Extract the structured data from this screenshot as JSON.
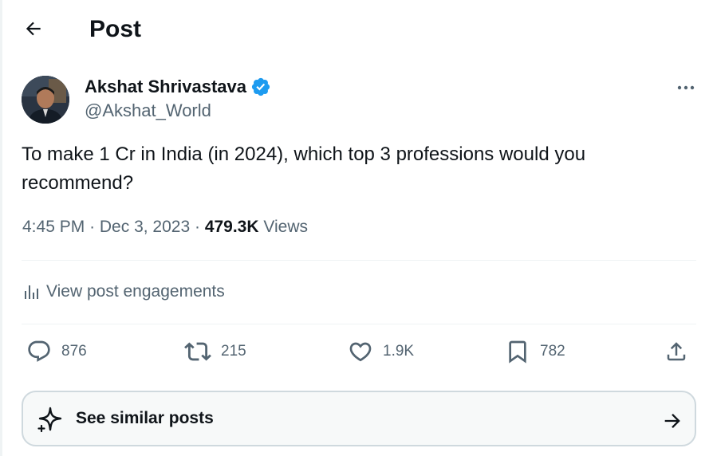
{
  "header": {
    "title": "Post"
  },
  "author": {
    "name": "Akshat Shrivastava",
    "handle": "@Akshat_World",
    "verified": true
  },
  "post": {
    "text": "To make 1 Cr in India (in 2024), which top 3 professions would you recommend?",
    "time": "4:45 PM",
    "date": "Dec 3, 2023",
    "views_count": "479.3K",
    "views_label": "Views"
  },
  "engagements": {
    "label": "View post engagements"
  },
  "actions": {
    "replies": "876",
    "reposts": "215",
    "likes": "1.9K",
    "bookmarks": "782"
  },
  "similar": {
    "label": "See similar posts"
  },
  "colors": {
    "verified": "#1d9bf0",
    "text": "#0f1419",
    "muted": "#536471",
    "border": "#eff3f4"
  }
}
